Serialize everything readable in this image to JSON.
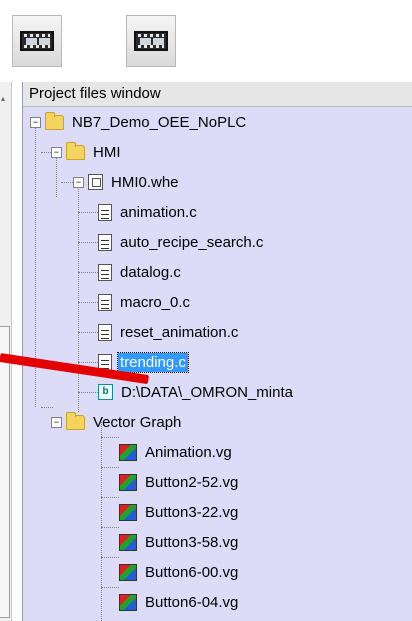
{
  "toolbar": {
    "buttons": [
      {
        "icon": "film-icon"
      },
      {
        "icon": "film-icon"
      }
    ]
  },
  "project_window": {
    "title": "Project files window",
    "tree": {
      "root": "NB7_Demo_OEE_NoPLC",
      "hmi": "HMI",
      "hmi_file": "HMI0.whe",
      "source_files": [
        "animation.c",
        "auto_recipe_search.c",
        "datalog.c",
        "macro_0.c",
        "reset_animation.c",
        "trending.c"
      ],
      "selected": "trending.c",
      "database_file": "D:\\DATA\\_OMRON_minta",
      "vector_folder": "Vector Graph",
      "vector_files": [
        "Animation.vg",
        "Button2-52.vg",
        "Button3-22.vg",
        "Button3-58.vg",
        "Button6-00.vg",
        "Button6-04.vg"
      ]
    }
  },
  "colors": {
    "window_bg": "#dcdcf8",
    "selection": "#3399ff",
    "arrow": "#e50000"
  }
}
